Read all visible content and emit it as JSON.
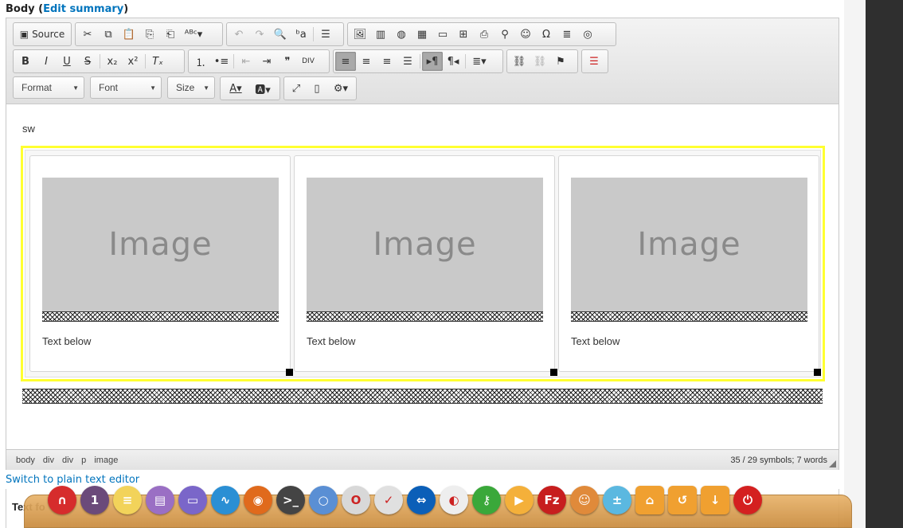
{
  "header": {
    "field_label": "Body",
    "edit_summary_link": "Edit summary",
    "paren_open": "(",
    "paren_close": ")"
  },
  "toolbar": {
    "source_label": "Source",
    "format_label": "Format",
    "font_label": "Font",
    "size_label": "Size",
    "row1_icons": [
      "source-icon",
      "cut-icon",
      "copy-icon",
      "paste-icon",
      "paste-text-icon",
      "paste-word-icon",
      "spellcheck-icon",
      "undo-icon",
      "redo-icon",
      "find-icon",
      "replace-icon",
      "select-all-icon",
      "image-icon",
      "flash-icon",
      "iframe-icon",
      "media-icon",
      "horizontal-rule-icon",
      "table-icon",
      "form-icon",
      "map-pin-icon",
      "smiley-icon",
      "special-char-icon",
      "page-break-icon",
      "globe-icon"
    ],
    "row2_icons": [
      "bold-icon",
      "italic-icon",
      "underline-icon",
      "strike-icon",
      "subscript-icon",
      "superscript-icon",
      "remove-format-icon",
      "numbered-list-icon",
      "bulleted-list-icon",
      "outdent-icon",
      "indent-icon",
      "blockquote-icon",
      "div-icon",
      "align-left-icon",
      "align-center-icon",
      "align-right-icon",
      "justify-icon",
      "ltr-icon",
      "rtl-icon",
      "language-icon",
      "link-icon",
      "unlink-icon",
      "anchor-icon",
      "template-icon"
    ],
    "row3_icons": [
      "text-color-icon",
      "bg-color-icon",
      "maximize-icon",
      "show-blocks-icon",
      "settings-icon"
    ]
  },
  "content": {
    "first_line": "sw",
    "cards": [
      {
        "image_text": "Image",
        "caption": "Text below"
      },
      {
        "image_text": "Image",
        "caption": "Text below"
      },
      {
        "image_text": "Image",
        "caption": "Text below"
      }
    ]
  },
  "statusbar": {
    "path": [
      "body",
      "div",
      "div",
      "p",
      "image"
    ],
    "counter": "35 / 29 symbols; 7 words"
  },
  "below_editor": {
    "switch_link": "Switch to plain text editor",
    "text_format_label": "Text fo"
  },
  "dock": {
    "apps": [
      {
        "name": "app-red-icon",
        "color": "#d62c2c",
        "glyph": "∩"
      },
      {
        "name": "workspace-switcher-icon",
        "color": "#6b4a7a",
        "glyph": "1"
      },
      {
        "name": "notes-icon",
        "color": "#f2d35a",
        "glyph": "≡"
      },
      {
        "name": "document-icon",
        "color": "#9a6fc4",
        "glyph": "▤"
      },
      {
        "name": "files-icon",
        "color": "#7a66c9",
        "glyph": "▭"
      },
      {
        "name": "monitor-icon",
        "color": "#2a8fd4",
        "glyph": "∿"
      },
      {
        "name": "firefox-icon",
        "color": "#e06a1c",
        "glyph": "◉"
      },
      {
        "name": "terminal-icon",
        "color": "#444444",
        "glyph": ">_"
      },
      {
        "name": "search-app-icon",
        "color": "#5a8fd4",
        "glyph": "○"
      },
      {
        "name": "opera-icon",
        "color": "#d8d8d8",
        "glyph": "O"
      },
      {
        "name": "mail-icon",
        "color": "#e0e0e0",
        "glyph": "✓"
      },
      {
        "name": "teamviewer-icon",
        "color": "#0b5fb8",
        "glyph": "⇔"
      },
      {
        "name": "clock-app-icon",
        "color": "#eeeeee",
        "glyph": "◐"
      },
      {
        "name": "key-icon",
        "color": "#3aa83a",
        "glyph": "⚷"
      },
      {
        "name": "media-player-icon",
        "color": "#f4b03a",
        "glyph": "▶"
      },
      {
        "name": "filezilla-icon",
        "color": "#c71e1e",
        "glyph": "Fz"
      },
      {
        "name": "gimp-icon",
        "color": "#e08a3a",
        "glyph": "☺"
      },
      {
        "name": "calculator-icon",
        "color": "#5bb8e0",
        "glyph": "±"
      },
      {
        "name": "home-folder-icon",
        "color": "#f0a030",
        "glyph": "⌂"
      },
      {
        "name": "recent-folder-icon",
        "color": "#f0a030",
        "glyph": "↺"
      },
      {
        "name": "downloads-folder-icon",
        "color": "#f0a030",
        "glyph": "↓"
      },
      {
        "name": "power-icon",
        "color": "#d42020",
        "glyph": "⏻"
      }
    ]
  }
}
